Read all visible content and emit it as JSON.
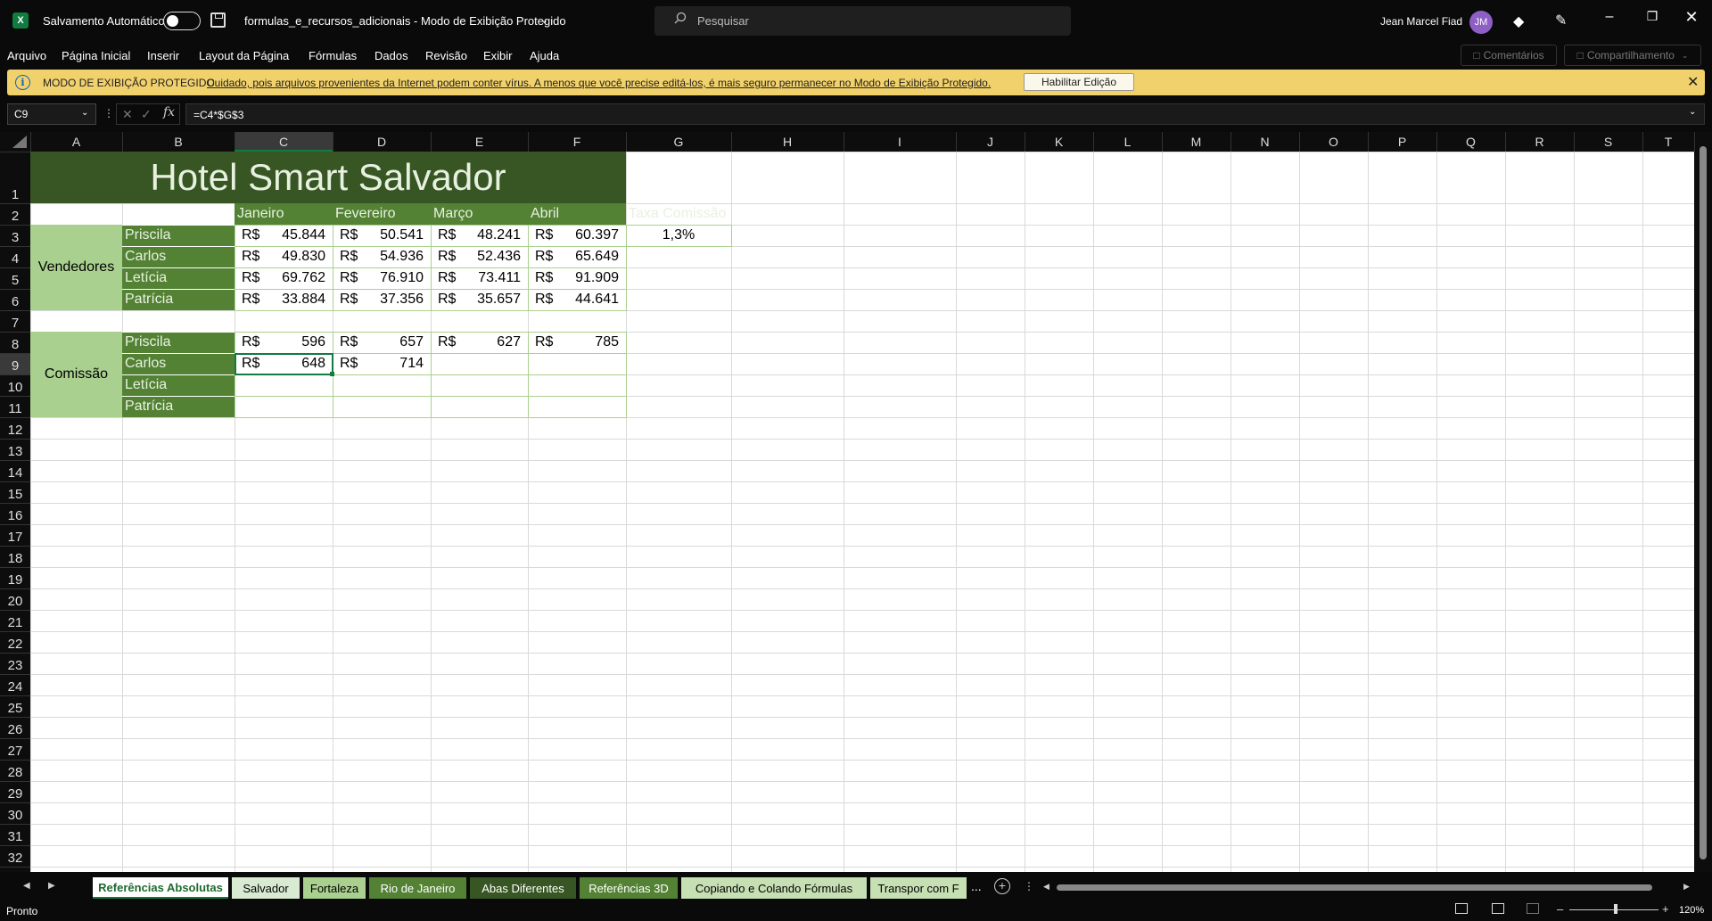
{
  "titlebar": {
    "autosave_label": "Salvamento Automático",
    "doc_title": "formulas_e_recursos_adicionais  -  Modo de Exibição Protegido",
    "search_placeholder": "Pesquisar",
    "user_name": "Jean Marcel Fiad",
    "avatar_initials": "JM"
  },
  "menu": [
    "Arquivo",
    "Página Inicial",
    "Inserir",
    "Layout da Página",
    "Fórmulas",
    "Dados",
    "Revisão",
    "Exibir",
    "Ajuda"
  ],
  "ribbon_right": {
    "comments": "Comentários",
    "share": "Compartilhamento"
  },
  "protected_view": {
    "title": "MODO DE EXIBIÇÃO PROTEGIDO",
    "message": "Cuidado, pois arquivos provenientes da Internet podem conter vírus. A menos que você precise editá-los, é mais seguro permanecer no Modo de  Exibição Protegido.",
    "enable_button": "Habilitar Edição"
  },
  "formula_bar": {
    "name_box": "C9",
    "formula": "=C4*$G$3"
  },
  "columns": [
    "A",
    "B",
    "C",
    "D",
    "E",
    "F",
    "G",
    "H",
    "I",
    "J",
    "K",
    "L",
    "M",
    "N",
    "O",
    "P",
    "Q",
    "R",
    "S",
    "T"
  ],
  "rows": [
    "1",
    "2",
    "3",
    "4",
    "5",
    "6",
    "7",
    "8",
    "9",
    "10",
    "11",
    "12",
    "13",
    "14",
    "15",
    "16",
    "17",
    "18",
    "19",
    "20",
    "21",
    "22",
    "23",
    "24",
    "25",
    "26",
    "27",
    "28",
    "29",
    "30",
    "31",
    "32"
  ],
  "sheet": {
    "title": "Hotel Smart Salvador",
    "headers": [
      "Janeiro",
      "Fevereiro",
      "Março",
      "Abril",
      "Taxa Comissão"
    ],
    "group_sales": "Vendedores",
    "group_commission": "Comissão",
    "names": [
      "Priscila",
      "Carlos",
      "Letícia",
      "Patrícia"
    ],
    "currency": "R$",
    "sales": [
      [
        "45.844",
        "50.541",
        "48.241",
        "60.397"
      ],
      [
        "49.830",
        "54.936",
        "52.436",
        "65.649"
      ],
      [
        "69.762",
        "76.910",
        "73.411",
        "91.909"
      ],
      [
        "33.884",
        "37.356",
        "35.657",
        "44.641"
      ]
    ],
    "rate": "1,3%",
    "commission": [
      [
        "596",
        "657",
        "627",
        "785"
      ],
      [
        "648",
        "714",
        "",
        ""
      ],
      [
        "",
        "",
        "",
        ""
      ],
      [
        "",
        "",
        "",
        ""
      ]
    ]
  },
  "tabs": [
    "Referências Absolutas",
    "Salvador",
    "Fortaleza",
    "Rio de Janeiro",
    "Abas Diferentes",
    "Referências 3D",
    "Copiando e Colando Fórmulas",
    "Transpor com F"
  ],
  "tab_more": "...",
  "status": {
    "ready": "Pronto",
    "zoom": "120%"
  },
  "colors": {
    "dark_green": "#375623",
    "mid_green": "#548235",
    "light_green": "#a9d08e",
    "protected_bar": "#f1d16b"
  }
}
